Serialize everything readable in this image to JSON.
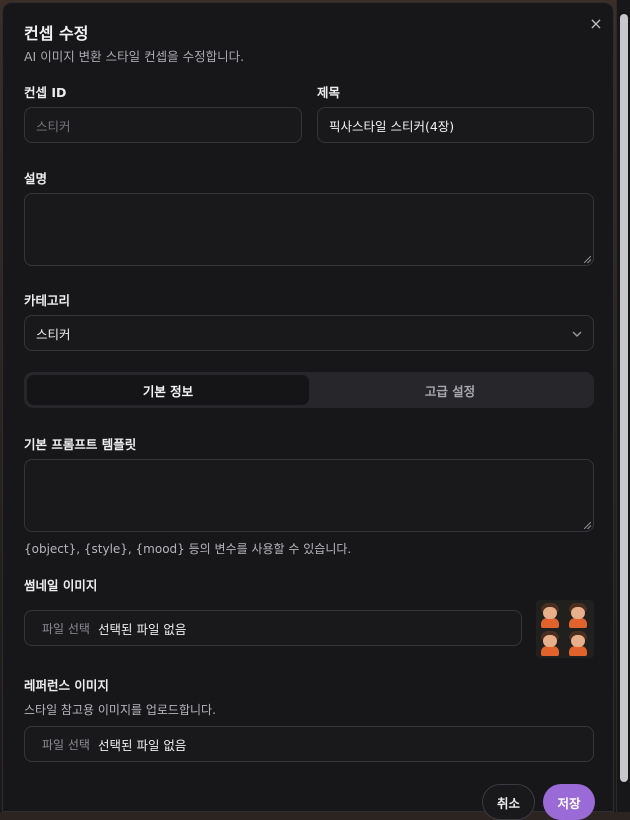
{
  "dialog": {
    "title": "컨셉 수정",
    "subtitle": "AI 이미지 변환 스타일 컨셉을 수정합니다.",
    "close_label": "×"
  },
  "fields": {
    "concept_id": {
      "label": "컨셉 ID",
      "value": "",
      "placeholder": "스티커"
    },
    "title": {
      "label": "제목",
      "value": "픽사스타일 스티커(4장)"
    },
    "description": {
      "label": "설명",
      "value": ""
    },
    "category": {
      "label": "카테고리",
      "value": "스티커"
    }
  },
  "tabs": [
    {
      "label": "기본 정보",
      "active": true
    },
    {
      "label": "고급 설정",
      "active": false
    }
  ],
  "prompt_template": {
    "label": "기본 프롬프트 템플릿",
    "value": "",
    "helper": "{object}, {style}, {mood} 등의 변수를 사용할 수 있습니다."
  },
  "thumbnail": {
    "label": "썸네일 이미지",
    "file_button": "파일 선택",
    "file_status": "선택된 파일 없음"
  },
  "reference": {
    "label": "레퍼런스 이미지",
    "helper": "스타일 참고용 이미지를 업로드합니다.",
    "file_button": "파일 선택",
    "file_status": "선택된 파일 없음"
  },
  "footer": {
    "cancel_label": "취소",
    "save_label": "저장"
  },
  "colors": {
    "dialog_bg": "#17171a",
    "accent": "#9a6ad6",
    "border": "#34343a"
  },
  "icons": {
    "close": "close-icon",
    "select_chevron": "chevron-down-icon"
  }
}
